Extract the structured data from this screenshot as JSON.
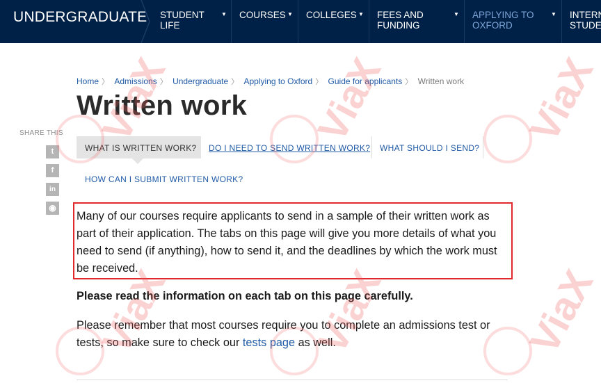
{
  "nav": {
    "brand": "UNDERGRADUATE",
    "items": [
      {
        "line1": "STUDENT",
        "line2": "LIFE"
      },
      {
        "line1": "COURSES",
        "line2": ""
      },
      {
        "line1": "COLLEGES",
        "line2": ""
      },
      {
        "line1": "FEES AND",
        "line2": "FUNDING"
      },
      {
        "line1": "APPLYING TO",
        "line2": "OXFORD"
      },
      {
        "line1": "INTERN",
        "line2": "STUDEN"
      }
    ],
    "caret": "▼",
    "active_color": "#7ea6d8",
    "bg_color": "#002147"
  },
  "breadcrumb": {
    "items": [
      "Home",
      "Admissions",
      "Undergraduate",
      "Applying to Oxford",
      "Guide for applicants"
    ],
    "current": "Written work",
    "separator": "〉"
  },
  "page": {
    "title": "Written work"
  },
  "share": {
    "label": "SHARE THIS",
    "buttons": [
      {
        "icon": "twitter-icon",
        "glyph": "t"
      },
      {
        "icon": "facebook-icon",
        "glyph": "f"
      },
      {
        "icon": "linkedin-icon",
        "glyph": "in"
      },
      {
        "icon": "reddit-icon",
        "glyph": "◉"
      }
    ]
  },
  "tabs": [
    {
      "label": "WHAT IS WRITTEN WORK?",
      "active": true
    },
    {
      "label": "DO I NEED TO SEND WRITTEN WORK?",
      "active": false
    },
    {
      "label": "WHAT SHOULD I SEND?",
      "active": false
    },
    {
      "label": "HOW CAN I SUBMIT WRITTEN WORK?",
      "active": false
    }
  ],
  "content": {
    "intro": "Many of our courses require applicants to send in a sample of their written work as part of their application. The tabs on this page will give you more details of what you need to send (if anything), how to send it, and the deadlines by which the work must be received.",
    "bold_note": "Please read the information on each tab on this page carefully.",
    "reminder_before": "Please remember that most courses require you to complete an admissions test or tests, so make sure to check our ",
    "reminder_link": "tests page",
    "reminder_after": " as well."
  },
  "watermark": {
    "text": "ViaX",
    "color": "#f05f5f"
  }
}
